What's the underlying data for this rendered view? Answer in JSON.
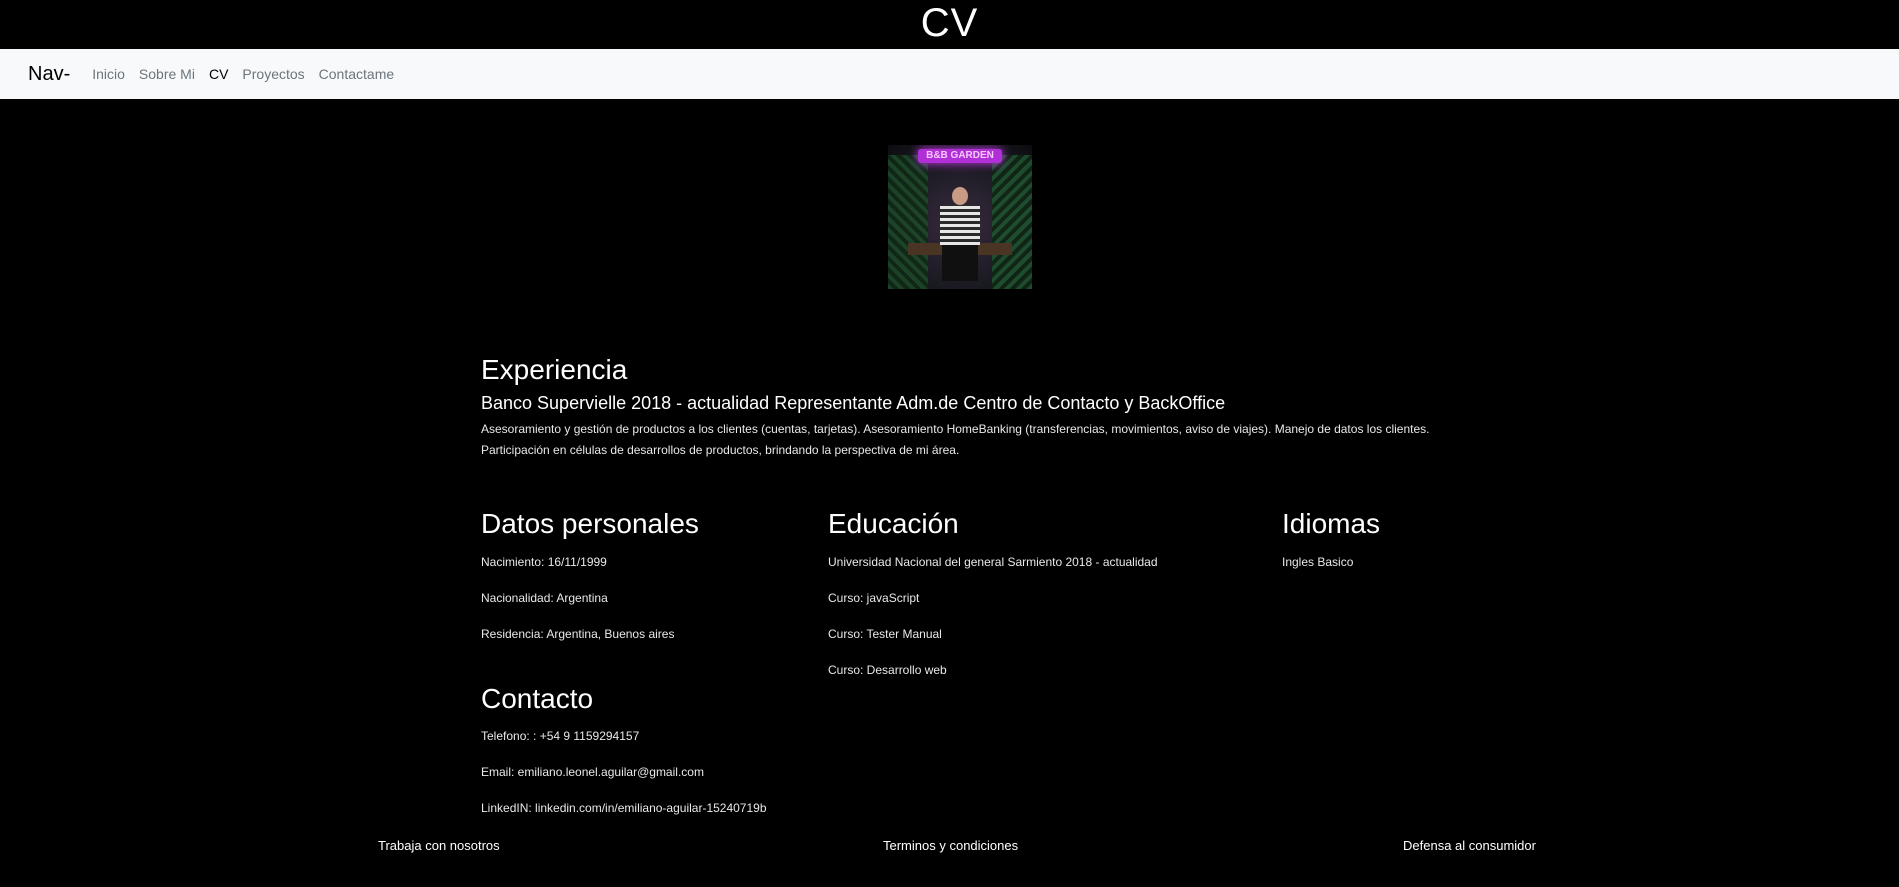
{
  "header": {
    "title": "CV"
  },
  "nav": {
    "brand": "Nav-",
    "links": [
      {
        "label": "Inicio"
      },
      {
        "label": "Sobre Mi"
      },
      {
        "label": "CV"
      },
      {
        "label": "Proyectos"
      },
      {
        "label": "Contactame"
      }
    ]
  },
  "photo": {
    "sign_text": "B&B GARDEN"
  },
  "experience": {
    "heading": "Experiencia",
    "job_title": "Banco Supervielle 2018 - actualidad Representante Adm.de Centro de Contacto y BackOffice",
    "description": "Asesoramiento y gestión de productos a los clientes (cuentas, tarjetas). Asesoramiento HomeBanking (transferencias, movimientos, aviso de viajes). Manejo de datos los clientes. Participación en células de desarrollos de productos, brindando la perspectiva de mi área."
  },
  "personal": {
    "heading": "Datos personales",
    "items": [
      "Nacimiento: 16/11/1999",
      "Nacionalidad: Argentina",
      "Residencia: Argentina, Buenos aires"
    ]
  },
  "education": {
    "heading": "Educación",
    "items": [
      "Universidad Nacional del general Sarmiento 2018 - actualidad",
      "Curso: javaScript",
      "Curso: Tester Manual",
      "Curso: Desarrollo web"
    ]
  },
  "languages": {
    "heading": "Idiomas",
    "items": [
      "Ingles Basico"
    ]
  },
  "contact": {
    "heading": "Contacto",
    "items": [
      "Telefono: : +54 9 1159294157",
      "Email: emiliano.leonel.aguilar@gmail.com",
      "LinkedIN: linkedin.com/in/emiliano-aguilar-15240719b"
    ]
  },
  "footer": {
    "links": [
      "Trabaja con nosotros",
      "Terminos y condiciones",
      "Defensa al consumidor"
    ]
  }
}
